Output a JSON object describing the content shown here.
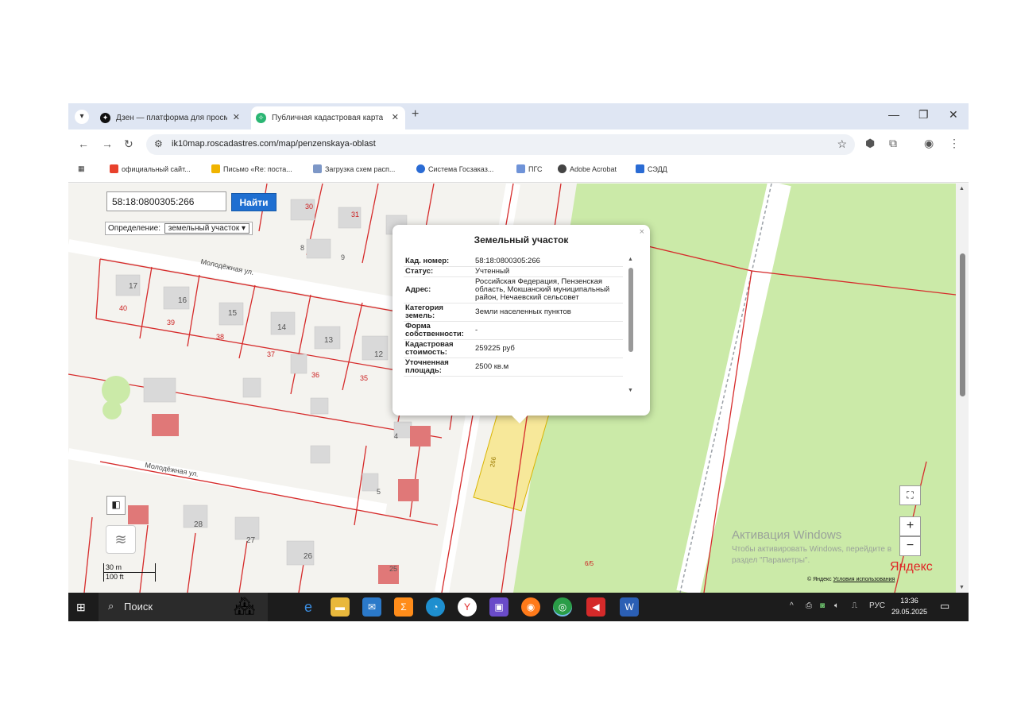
{
  "browser": {
    "tabs": [
      {
        "label": "Дзен — платформа для просм",
        "icon": "dzen-icon",
        "color": "#111111"
      },
      {
        "label": "Публичная кадастровая карта",
        "icon": "map-tab-icon",
        "color": "#2bb673",
        "active": true
      }
    ],
    "tab_close": "✕",
    "new_tab": "+",
    "url": "ik10map.roscadastres.com/map/penzenskaya-oblast",
    "bookmarks": [
      {
        "label": "официальный сайт...",
        "color": "#e8412c"
      },
      {
        "label": "Письмо «Re: поста...",
        "color": "#f0b400"
      },
      {
        "label": "Загрузка схем расп...",
        "color": "#7d97c7"
      },
      {
        "label": "Система Госзаказ...",
        "color": "#2a6bd4"
      },
      {
        "label": "ПГС",
        "color": "#6f93d8"
      },
      {
        "label": "Adobe Acrobat",
        "color": "#444444"
      },
      {
        "label": "СЭДД",
        "color": "#2a6bd4"
      }
    ]
  },
  "map": {
    "search_value": "58:18:0800305:266",
    "find_label": "Найти",
    "definition_label": "Определение:",
    "definition_value": "земельный участок",
    "street_label": "Молодёжная ул.",
    "parcel_numbers": [
      "17",
      "16",
      "15",
      "14",
      "13",
      "12",
      "40",
      "39",
      "38",
      "37",
      "36",
      "35",
      "30",
      "31",
      "8",
      "9",
      "28",
      "27",
      "26",
      "25",
      "5",
      "4",
      "6/5",
      "266"
    ],
    "popup": {
      "title": "Земельный участок",
      "rows": [
        {
          "key": "Кад. номер:",
          "value": "58:18:0800305:266"
        },
        {
          "key": "Статус:",
          "value": "Учтенный"
        },
        {
          "key": "Адрес:",
          "value": "Российская Федерация, Пензенская область, Мокшанский муниципальный район, Нечаевский сельсовет"
        },
        {
          "key": "Категория земель:",
          "value": "Земли населенных пунктов"
        },
        {
          "key": "Форма собственности:",
          "value": "-"
        },
        {
          "key": "Кадастровая стоимость:",
          "value": "259225 руб"
        },
        {
          "key": "Уточненная площадь:",
          "value": "2500 кв.м"
        }
      ]
    },
    "zoom_in": "+",
    "zoom_out": "−",
    "scale_metric": "30 m",
    "scale_imperial": "100 ft",
    "yandex": "Яндекс",
    "yandex_terms_prefix": "© Яндекс",
    "yandex_terms_link": "Условия использования",
    "colors": {
      "boundary": "#d62b2b",
      "building": "#d9d9d9",
      "selected_parcel": "#f7e89a",
      "field": "#cbeaa8"
    }
  },
  "activation": {
    "title": "Активация Windows",
    "line1": "Чтобы активировать Windows, перейдите в",
    "line2": "раздел \"Параметры\"."
  },
  "taskbar": {
    "search_placeholder": "Поиск",
    "language": "РУС",
    "time": "13:36",
    "date": "29.05.2025"
  }
}
